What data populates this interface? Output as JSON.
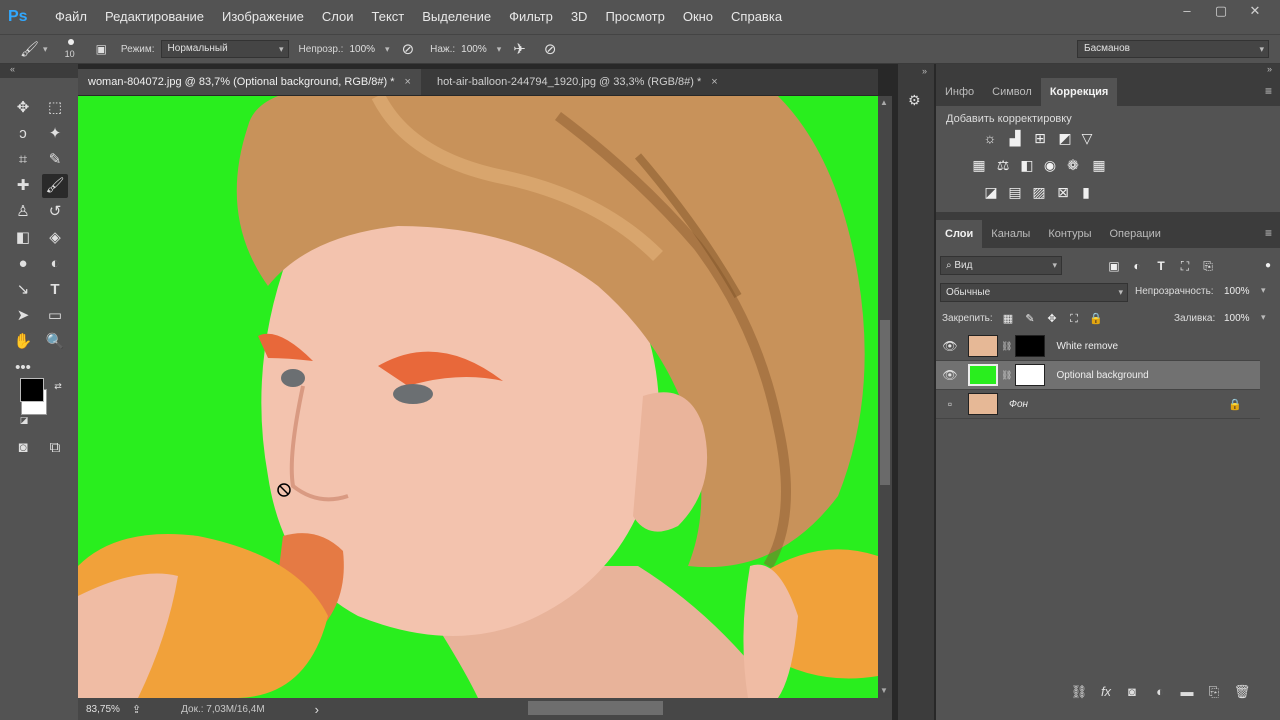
{
  "app": {
    "logo": "Ps"
  },
  "menu": [
    "Файл",
    "Редактирование",
    "Изображение",
    "Слои",
    "Текст",
    "Выделение",
    "Фильтр",
    "3D",
    "Просмотр",
    "Окно",
    "Справка"
  ],
  "window_controls": [
    "minimize-icon",
    "restore-icon",
    "close-icon"
  ],
  "options": {
    "brush_size": "10",
    "mode_label": "Режим:",
    "mode_value": "Нормальный",
    "opacity_label": "Непрозр.:",
    "opacity_value": "100%",
    "pressure_label": "Наж.:",
    "pressure_value": "100%",
    "workspace": "Басманов"
  },
  "tabs": [
    {
      "title": "woman-804072.jpg @ 83,7% (Optional background, RGB/8#) *",
      "close": "×"
    },
    {
      "title": "hot-air-balloon-244794_1920.jpg @ 33,3% (RGB/8#) *",
      "close": "×"
    }
  ],
  "status": {
    "zoom": "83,75%",
    "doc": "Док.: 7,03M/16,4M",
    "arrow": "›"
  },
  "colors": {
    "foreground": "#000000",
    "background": "#ffffff",
    "canvas_bg": "#29ee1e"
  },
  "panel_top": {
    "tabs": [
      "Инфо",
      "Символ",
      "Коррекция"
    ],
    "adjust_title": "Добавить корректировку"
  },
  "layers_panel": {
    "tabs": [
      "Слои",
      "Каналы",
      "Контуры",
      "Операции"
    ],
    "filter_label": "Вид",
    "blend_mode": "Обычные",
    "opacity_label": "Непрозрачность:",
    "opacity_value": "100%",
    "lock_label": "Закрепить:",
    "fill_label": "Заливка:",
    "fill_value": "100%",
    "layers": [
      {
        "name": "White remove",
        "visible": true,
        "selected": false
      },
      {
        "name": "Optional background",
        "visible": true,
        "selected": true
      },
      {
        "name": "Фон",
        "visible": false,
        "selected": false,
        "locked": true
      }
    ]
  }
}
